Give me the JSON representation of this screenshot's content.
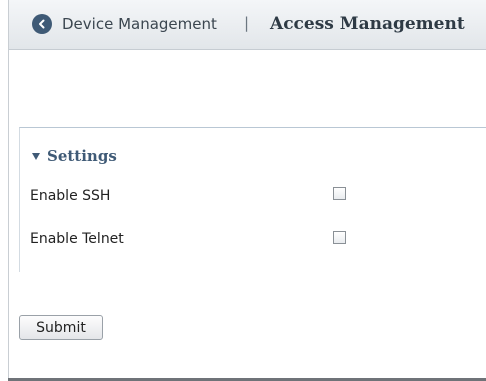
{
  "header": {
    "back_icon": "back-arrow-icon",
    "breadcrumb_parent": "Device Management",
    "breadcrumb_separator": "|",
    "page_title": "Access Management"
  },
  "settings": {
    "title": "Settings",
    "rows": [
      {
        "label": "Enable SSH",
        "checked": false
      },
      {
        "label": "Enable Telnet",
        "checked": false
      }
    ]
  },
  "actions": {
    "submit_label": "Submit"
  },
  "colors": {
    "accent": "#3f5a76",
    "header_bg": "#e8ebee"
  }
}
